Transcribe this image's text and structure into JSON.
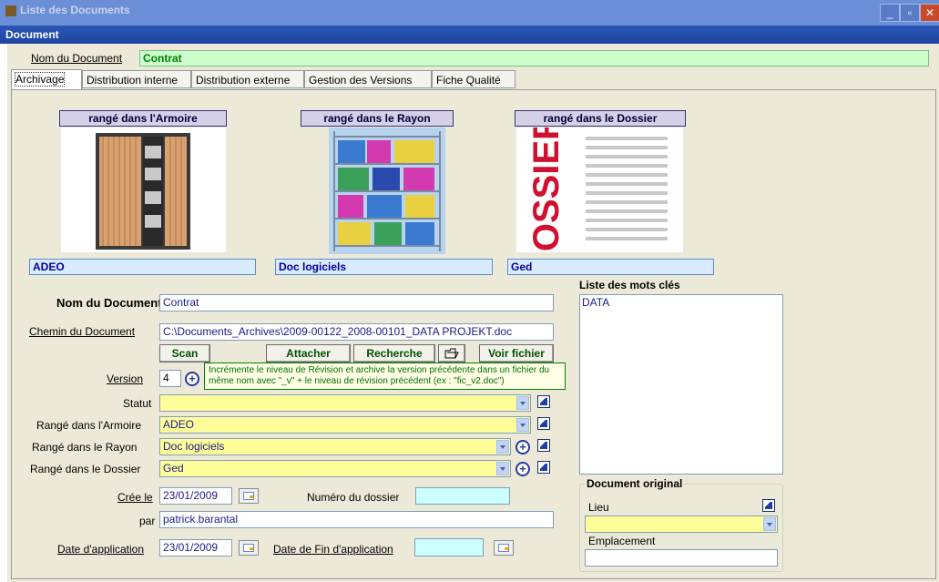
{
  "window": {
    "title": "Liste des Documents"
  },
  "header": {
    "title": "Document"
  },
  "top": {
    "nom_label": "Nom du Document",
    "nom_value": "Contrat"
  },
  "tabs": [
    {
      "label": "Archivage"
    },
    {
      "label": "Distribution interne"
    },
    {
      "label": "Distribution externe"
    },
    {
      "label": "Gestion des Versions"
    },
    {
      "label": "Fiche Qualité"
    }
  ],
  "storage": {
    "armoire": {
      "caption": "rangé dans l'Armoire",
      "value": "ADEO"
    },
    "rayon": {
      "caption": "rangé dans le Rayon",
      "value": "Doc logiciels"
    },
    "dossier": {
      "caption": "rangé dans le Dossier",
      "value": "Ged",
      "image_text": "DOSSIER"
    }
  },
  "form": {
    "nom_label": "Nom du Document",
    "nom_value": "Contrat",
    "chemin_label": "Chemin du Document",
    "chemin_value": "C:\\Documents_Archives\\2009-00122_2008-00101_DATA PROJEKT.doc",
    "buttons": {
      "scan": "Scan",
      "attacher": "Attacher",
      "recherche": "Recherche",
      "voir": "Voir fichier"
    },
    "version_label": "Version",
    "version_value": "4",
    "tooltip": "Incrémente le niveau de Révision et archive la version précédente dans un fichier du même nom avec \"_v\" + le niveau de révision précédent (ex : \"fic_v2.doc\")",
    "statut_label": "Statut",
    "statut_value": "",
    "armoire_label": "Rangé dans l'Armoire",
    "armoire_value": "ADEO",
    "rayon_label": "Rangé dans le Rayon",
    "rayon_value": "Doc logiciels",
    "dossier_label": "Rangé dans le Dossier",
    "dossier_value": "Ged",
    "cree_label": "Crée le",
    "cree_value": "23/01/2009",
    "numero_label": "Numéro du dossier",
    "numero_value": "",
    "par_label": "par",
    "par_value": "patrick.barantal",
    "date_app_label": "Date d'application",
    "date_app_value": "23/01/2009",
    "date_fin_label": "Date de Fin d'application",
    "date_fin_value": ""
  },
  "keywords": {
    "label": "Liste des mots clés",
    "items": [
      "DATA"
    ]
  },
  "original": {
    "title": "Document original",
    "lieu_label": "Lieu",
    "lieu_value": "",
    "emplacement_label": "Emplacement",
    "emplacement_value": ""
  },
  "colors": {
    "header": "#1d45a0",
    "client": "#ece9d8",
    "green_field": "#ccffcc",
    "blue_field": "#d9ecff",
    "yellow_field": "#ffff99"
  }
}
